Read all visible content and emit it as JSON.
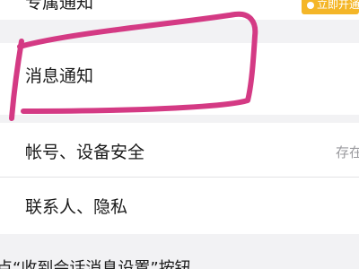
{
  "partial_row": {
    "label": "专属通知",
    "badge_text": "立即开通"
  },
  "settings": {
    "notifications_label": "消息通知",
    "account_security_label": "帐号、设备安全",
    "account_security_value": "存在",
    "contacts_privacy_label": "联系人、隐私"
  },
  "caption": "点“收到会话消息设置”按钮",
  "colors": {
    "annotation": "#d43a84",
    "badge": "#f4b628"
  }
}
